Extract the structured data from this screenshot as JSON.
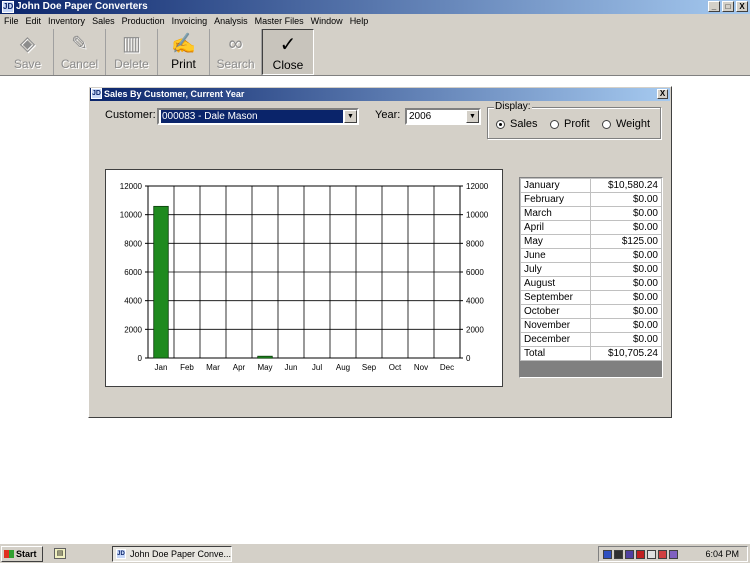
{
  "window": {
    "title": "John Doe Paper Converters",
    "minimize_glyph": "_",
    "maximize_glyph": "□",
    "close_glyph": "X"
  },
  "menu": [
    "File",
    "Edit",
    "Inventory",
    "Sales",
    "Production",
    "Invoicing",
    "Analysis",
    "Master Files",
    "Window",
    "Help"
  ],
  "toolbar": {
    "save": "Save",
    "cancel": "Cancel",
    "delete": "Delete",
    "print": "Print",
    "search": "Search",
    "close": "Close"
  },
  "dialog": {
    "title": "Sales By Customer, Current Year",
    "close_glyph": "X",
    "customer_label": "Customer:",
    "customer_value": "000083 - Dale Mason",
    "year_label": "Year:",
    "year_value": "2006",
    "display_label": "Display:",
    "display_options": [
      "Sales",
      "Profit",
      "Weight"
    ],
    "display_selected": "Sales"
  },
  "chart_data": {
    "type": "bar",
    "categories": [
      "Jan",
      "Feb",
      "Mar",
      "Apr",
      "May",
      "Jun",
      "Jul",
      "Aug",
      "Sep",
      "Oct",
      "Nov",
      "Dec"
    ],
    "values": [
      10580.24,
      0,
      0,
      0,
      125,
      0,
      0,
      0,
      0,
      0,
      0,
      0
    ],
    "ylim": [
      0,
      12000
    ],
    "yticks": [
      0,
      2000,
      4000,
      6000,
      8000,
      10000,
      12000
    ],
    "grid": true,
    "bar_color": "#1e8a1e",
    "title": "",
    "xlabel": "",
    "ylabel": ""
  },
  "month_table": [
    [
      "January",
      "$10,580.24"
    ],
    [
      "February",
      "$0.00"
    ],
    [
      "March",
      "$0.00"
    ],
    [
      "April",
      "$0.00"
    ],
    [
      "May",
      "$125.00"
    ],
    [
      "June",
      "$0.00"
    ],
    [
      "July",
      "$0.00"
    ],
    [
      "August",
      "$0.00"
    ],
    [
      "September",
      "$0.00"
    ],
    [
      "October",
      "$0.00"
    ],
    [
      "November",
      "$0.00"
    ],
    [
      "December",
      "$0.00"
    ],
    [
      "Total",
      "$10,705.24"
    ]
  ],
  "taskbar": {
    "start": "Start",
    "task_item": "John Doe Paper Conve...",
    "clock": "6:04 PM"
  },
  "colors": {
    "titlebar_start": "#0a246a",
    "titlebar_end": "#a6caf0",
    "face": "#d4d0c8",
    "selection": "#0a246a"
  }
}
